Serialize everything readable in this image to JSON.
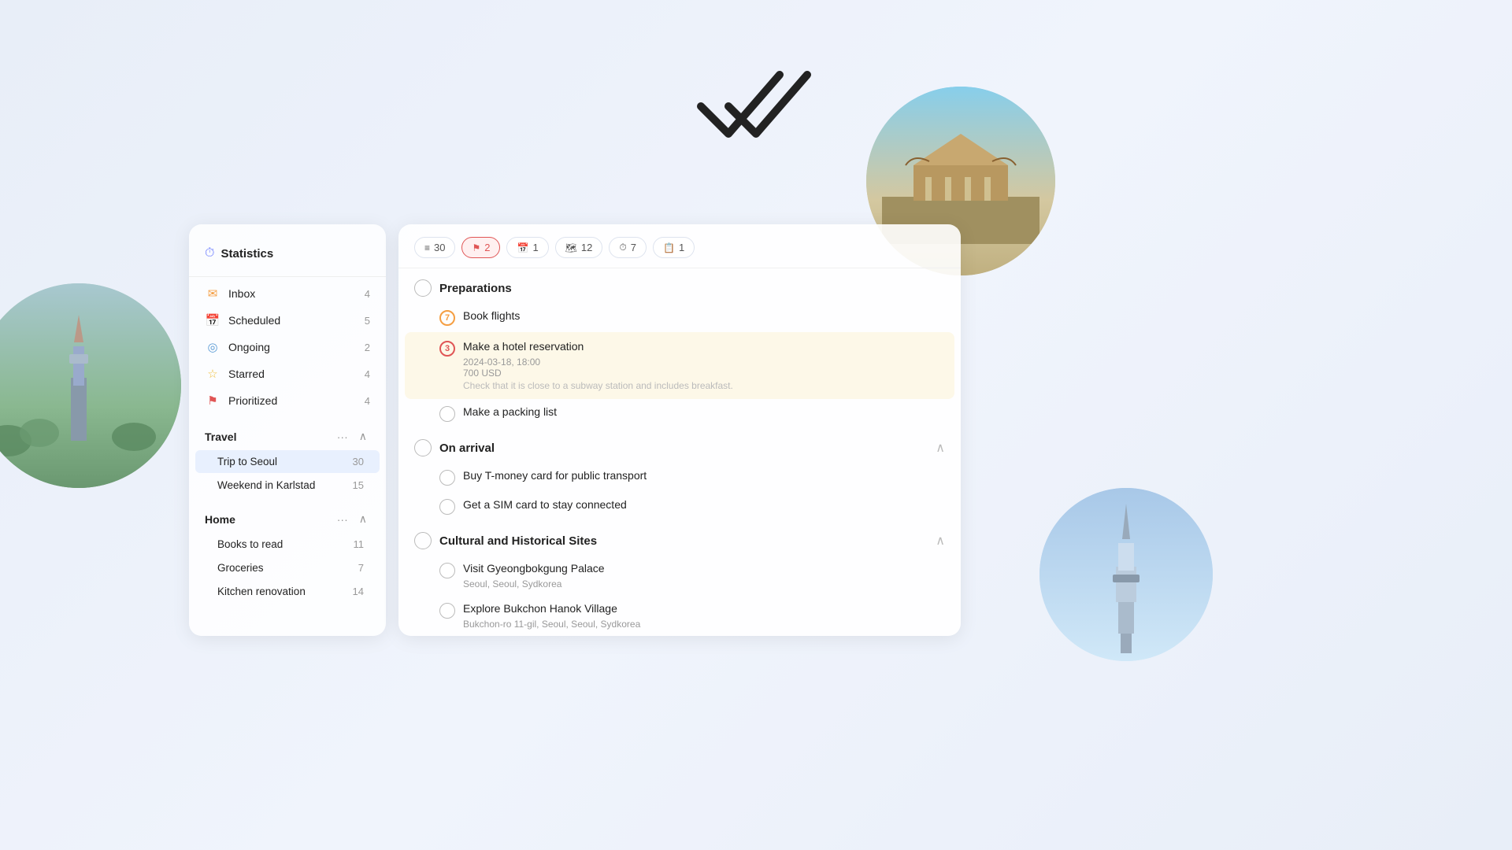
{
  "app": {
    "logo_symbol": "✓✓"
  },
  "sidebar": {
    "stats_label": "Statistics",
    "stats_icon": "⏱",
    "items": [
      {
        "id": "inbox",
        "label": "Inbox",
        "icon": "✉",
        "icon_class": "icon-inbox",
        "count": 4
      },
      {
        "id": "scheduled",
        "label": "Scheduled",
        "icon": "📅",
        "icon_class": "icon-scheduled",
        "count": 5
      },
      {
        "id": "ongoing",
        "label": "Ongoing",
        "icon": "◎",
        "icon_class": "icon-ongoing",
        "count": 2
      },
      {
        "id": "starred",
        "label": "Starred",
        "icon": "☆",
        "icon_class": "icon-starred",
        "count": 4
      },
      {
        "id": "prioritized",
        "label": "Prioritized",
        "icon": "⚑",
        "icon_class": "icon-prioritized",
        "count": 4
      }
    ],
    "groups": [
      {
        "id": "travel",
        "label": "Travel",
        "collapsed": false,
        "items": [
          {
            "id": "trip-to-seoul",
            "label": "Trip to Seoul",
            "count": 30,
            "active": true
          },
          {
            "id": "weekend-karlstad",
            "label": "Weekend in Karlstad",
            "count": 15,
            "active": false
          }
        ]
      },
      {
        "id": "home",
        "label": "Home",
        "collapsed": false,
        "items": [
          {
            "id": "books-to-read",
            "label": "Books to read",
            "count": 11,
            "active": false
          },
          {
            "id": "groceries",
            "label": "Groceries",
            "count": 7,
            "active": false
          },
          {
            "id": "kitchen-renovation",
            "label": "Kitchen renovation",
            "count": 14,
            "active": false
          }
        ]
      }
    ]
  },
  "filter_bar": {
    "chips": [
      {
        "id": "all",
        "label": "30",
        "icon": "≡",
        "active": false
      },
      {
        "id": "priority",
        "label": "2",
        "icon": "⚑",
        "active": true
      },
      {
        "id": "scheduled",
        "label": "1",
        "icon": "📅",
        "active": false
      },
      {
        "id": "map",
        "label": "12",
        "icon": "🗺",
        "active": false
      },
      {
        "id": "time",
        "label": "7",
        "icon": "⏱",
        "active": false
      },
      {
        "id": "calendar",
        "label": "1",
        "icon": "📋",
        "active": false
      }
    ]
  },
  "task_sections": [
    {
      "id": "preparations",
      "title": "Preparations",
      "collapsed": false,
      "tasks": [
        {
          "id": "book-flights",
          "title": "Book flights",
          "badge": "7",
          "badge_class": "badge-orange",
          "highlighted": false,
          "meta": null,
          "note": null
        },
        {
          "id": "hotel-reservation",
          "title": "Make a hotel reservation",
          "badge": "3",
          "badge_class": "badge-red",
          "highlighted": true,
          "meta": "2024-03-18, 18:00\n700 USD",
          "note": "Check that it is close to a subway station and includes breakfast."
        },
        {
          "id": "packing-list",
          "title": "Make a packing list",
          "badge": null,
          "badge_class": null,
          "highlighted": false,
          "meta": null,
          "note": null
        }
      ]
    },
    {
      "id": "on-arrival",
      "title": "On arrival",
      "collapsed": false,
      "tasks": [
        {
          "id": "t-money-card",
          "title": "Buy T-money card for public transport",
          "badge": null,
          "badge_class": null,
          "highlighted": false,
          "meta": null,
          "note": null
        },
        {
          "id": "sim-card",
          "title": "Get a SIM card to stay connected",
          "badge": null,
          "badge_class": null,
          "highlighted": false,
          "meta": null,
          "note": null
        }
      ]
    },
    {
      "id": "cultural-historical",
      "title": "Cultural and Historical Sites",
      "collapsed": false,
      "tasks": [
        {
          "id": "gyeongbokgung",
          "title": "Visit Gyeongbokgung Palace",
          "badge": null,
          "badge_class": null,
          "highlighted": false,
          "meta": "Seoul, Seoul, Sydkorea",
          "note": null
        },
        {
          "id": "bukchon",
          "title": "Explore Bukchon Hanok Village",
          "badge": null,
          "badge_class": null,
          "highlighted": false,
          "meta": "Bukchon-ro 11-gil, Seoul, Seoul, Sydkorea",
          "note": null
        }
      ]
    }
  ]
}
